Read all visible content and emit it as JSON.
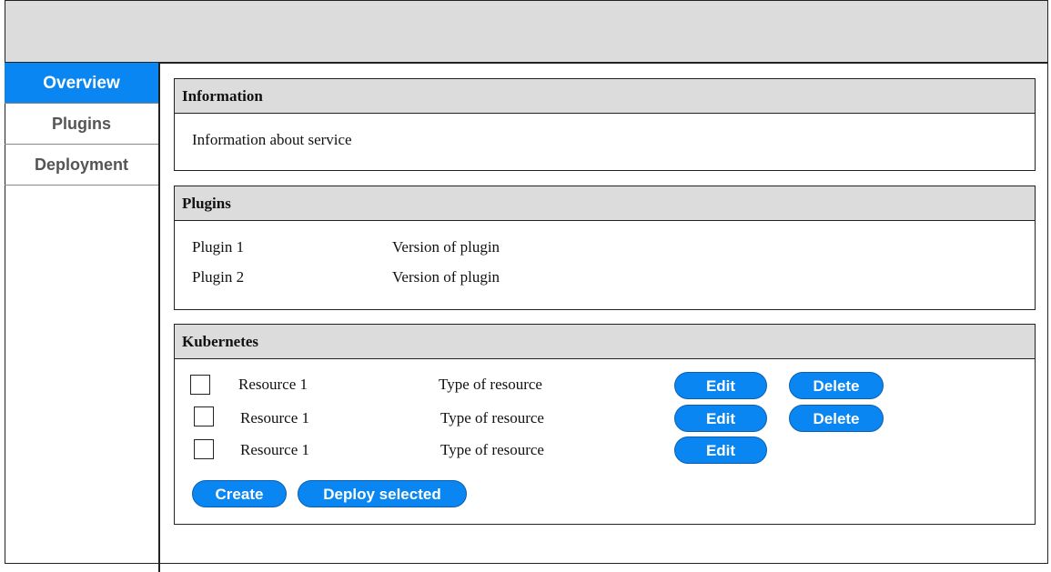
{
  "sidebar": {
    "items": [
      {
        "label": "Overview",
        "active": true
      },
      {
        "label": "Plugins",
        "active": false
      },
      {
        "label": "Deployment",
        "active": false
      }
    ]
  },
  "information": {
    "title": "Information",
    "text": "Information about service"
  },
  "plugins": {
    "title": "Plugins",
    "rows": [
      {
        "name": "Plugin 1",
        "version": "Version of plugin"
      },
      {
        "name": "Plugin 2",
        "version": "Version of plugin"
      }
    ]
  },
  "kubernetes": {
    "title": "Kubernetes",
    "rows": [
      {
        "name": "Resource 1",
        "type": "Type of resource",
        "edit_label": "Edit",
        "delete_label": "Delete"
      },
      {
        "name": "Resource 1",
        "type": "Type of resource",
        "edit_label": "Edit",
        "delete_label": "Delete"
      },
      {
        "name": "Resource 1",
        "type": "Type of resource",
        "edit_label": "Edit"
      }
    ],
    "create_label": "Create",
    "deploy_label": "Deploy selected"
  },
  "colors": {
    "accent": "#0a86f2",
    "header_bg": "#dcdcdc"
  }
}
